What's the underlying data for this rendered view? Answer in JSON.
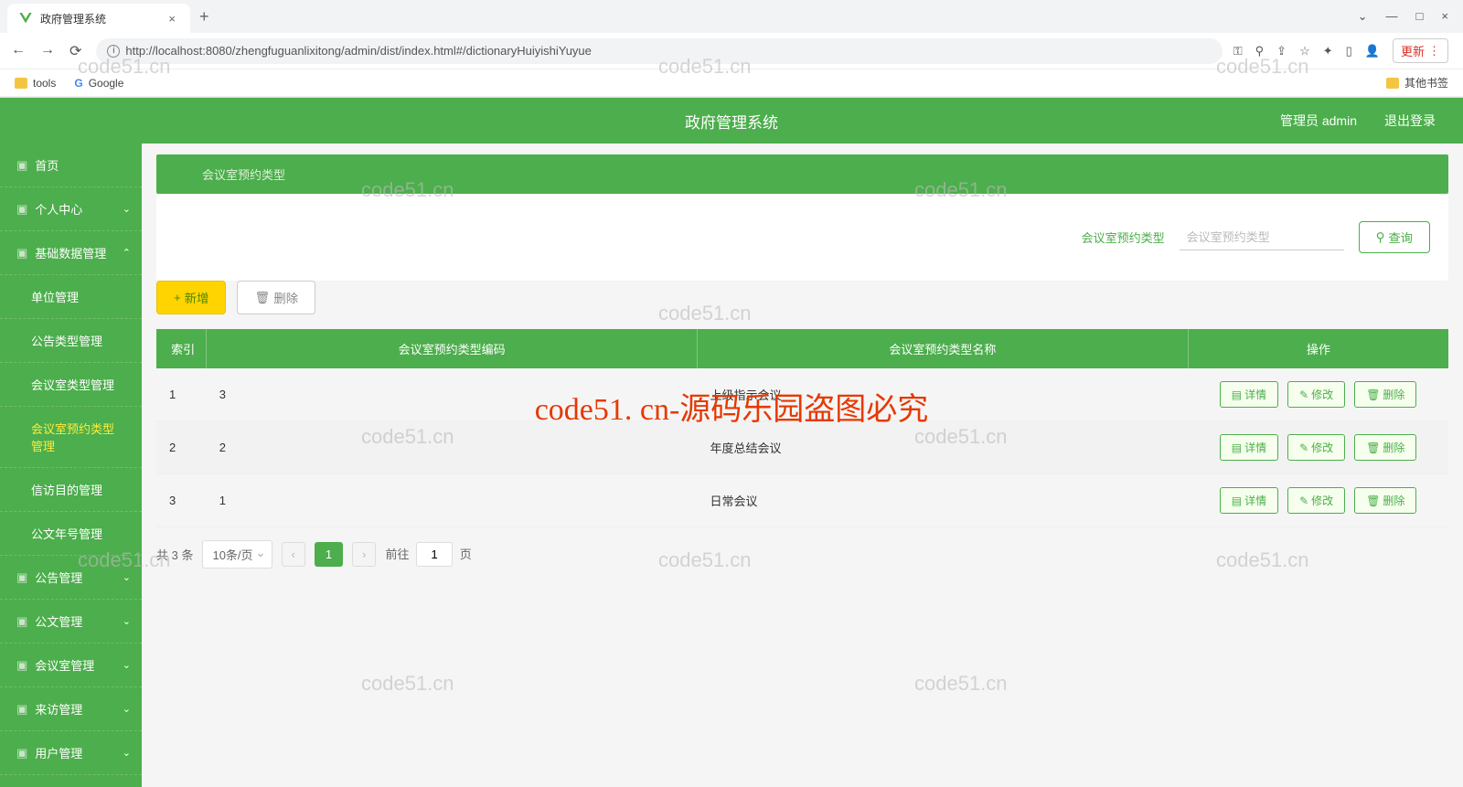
{
  "browser": {
    "tab_title": "政府管理系统",
    "url": "http://localhost:8080/zhengfuguanlixitong/admin/dist/index.html#/dictionaryHuiyishiYuyue",
    "update_label": "更新",
    "bookmarks": {
      "tools": "tools",
      "google": "Google",
      "other": "其他书签"
    }
  },
  "header": {
    "title": "政府管理系统",
    "user": "管理员 admin",
    "logout": "退出登录"
  },
  "sidebar": {
    "home": "首页",
    "profile": "个人中心",
    "basic_data": "基础数据管理",
    "sub": {
      "unit": "单位管理",
      "notice_type": "公告类型管理",
      "room_type": "会议室类型管理",
      "booking_type": "会议室预约类型管理",
      "petition": "信访目的管理",
      "doc_year": "公文年号管理"
    },
    "notice_mgmt": "公告管理",
    "doc_mgmt": "公文管理",
    "room_mgmt": "会议室管理",
    "visit_mgmt": "来访管理",
    "user_mgmt": "用户管理"
  },
  "breadcrumb": "会议室预约类型",
  "search": {
    "label": "会议室预约类型",
    "placeholder": "会议室预约类型",
    "button": "查询"
  },
  "toolbar": {
    "add": "新增",
    "delete": "删除"
  },
  "table": {
    "headers": {
      "index": "索引",
      "code": "会议室预约类型编码",
      "name": "会议室预约类型名称",
      "actions": "操作"
    },
    "rows": [
      {
        "idx": "1",
        "code": "3",
        "name": "上级指示会议"
      },
      {
        "idx": "2",
        "code": "2",
        "name": "年度总结会议"
      },
      {
        "idx": "3",
        "code": "1",
        "name": "日常会议"
      }
    ],
    "actions": {
      "detail": "详情",
      "edit": "修改",
      "delete": "删除"
    }
  },
  "pagination": {
    "total": "共 3 条",
    "page_size": "10条/页",
    "current": "1",
    "goto_prefix": "前往",
    "goto_value": "1",
    "goto_suffix": "页"
  },
  "watermark": "code51.cn",
  "watermark_red": "code51. cn-源码乐园盗图必究"
}
